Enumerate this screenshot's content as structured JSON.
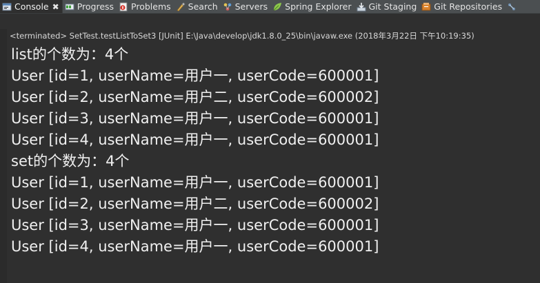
{
  "tabs": [
    {
      "label": "Console",
      "icon": "console-icon",
      "active": true,
      "closable": true
    },
    {
      "label": "Progress",
      "icon": "progress-icon",
      "active": false
    },
    {
      "label": "Problems",
      "icon": "problems-icon",
      "active": false
    },
    {
      "label": "Search",
      "icon": "search-icon",
      "active": false
    },
    {
      "label": "Servers",
      "icon": "servers-icon",
      "active": false
    },
    {
      "label": "Spring Explorer",
      "icon": "spring-leaf-icon",
      "active": false
    },
    {
      "label": "Git Staging",
      "icon": "git-staging-icon",
      "active": false
    },
    {
      "label": "Git Repositories",
      "icon": "git-repositories-icon",
      "active": false
    }
  ],
  "tab_close_glyph": "✖",
  "console": {
    "status": "<terminated> SetTest.testListToSet3 [JUnit] E:\\Java\\develop\\jdk1.8.0_25\\bin\\javaw.exe (2018年3月22日 下午10:19:35)",
    "lines": [
      "list的个数为：4个",
      "User [id=1, userName=用户一, userCode=600001]",
      "User [id=2, userName=用户二, userCode=600002]",
      "User [id=3, userName=用户一, userCode=600001]",
      "User [id=4, userName=用户一, userCode=600001]",
      "set的个数为：4个",
      "User [id=1, userName=用户一, userCode=600001]",
      "User [id=2, userName=用户二, userCode=600002]",
      "User [id=3, userName=用户一, userCode=600001]",
      "User [id=4, userName=用户一, userCode=600001]"
    ]
  },
  "colors": {
    "background": "#2f2f2f",
    "tabbar": "#4b4f51",
    "text": "#f0f0f0",
    "spring_green": "#8cc84b",
    "git_orange": "#d9822b"
  }
}
